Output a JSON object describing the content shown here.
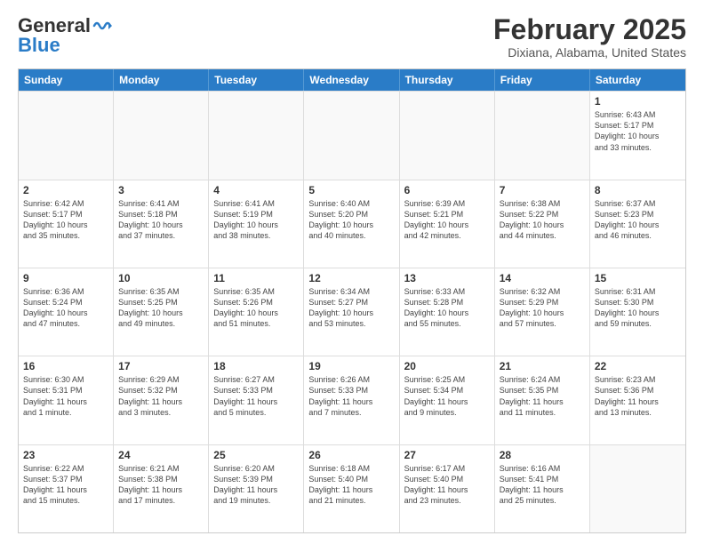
{
  "header": {
    "logo_general": "General",
    "logo_blue": "Blue",
    "month_title": "February 2025",
    "location": "Dixiana, Alabama, United States"
  },
  "weekdays": [
    "Sunday",
    "Monday",
    "Tuesday",
    "Wednesday",
    "Thursday",
    "Friday",
    "Saturday"
  ],
  "rows": [
    {
      "cells": [
        {
          "day": "",
          "info": ""
        },
        {
          "day": "",
          "info": ""
        },
        {
          "day": "",
          "info": ""
        },
        {
          "day": "",
          "info": ""
        },
        {
          "day": "",
          "info": ""
        },
        {
          "day": "",
          "info": ""
        },
        {
          "day": "1",
          "info": "Sunrise: 6:43 AM\nSunset: 5:17 PM\nDaylight: 10 hours\nand 33 minutes."
        }
      ]
    },
    {
      "cells": [
        {
          "day": "2",
          "info": "Sunrise: 6:42 AM\nSunset: 5:17 PM\nDaylight: 10 hours\nand 35 minutes."
        },
        {
          "day": "3",
          "info": "Sunrise: 6:41 AM\nSunset: 5:18 PM\nDaylight: 10 hours\nand 37 minutes."
        },
        {
          "day": "4",
          "info": "Sunrise: 6:41 AM\nSunset: 5:19 PM\nDaylight: 10 hours\nand 38 minutes."
        },
        {
          "day": "5",
          "info": "Sunrise: 6:40 AM\nSunset: 5:20 PM\nDaylight: 10 hours\nand 40 minutes."
        },
        {
          "day": "6",
          "info": "Sunrise: 6:39 AM\nSunset: 5:21 PM\nDaylight: 10 hours\nand 42 minutes."
        },
        {
          "day": "7",
          "info": "Sunrise: 6:38 AM\nSunset: 5:22 PM\nDaylight: 10 hours\nand 44 minutes."
        },
        {
          "day": "8",
          "info": "Sunrise: 6:37 AM\nSunset: 5:23 PM\nDaylight: 10 hours\nand 46 minutes."
        }
      ]
    },
    {
      "cells": [
        {
          "day": "9",
          "info": "Sunrise: 6:36 AM\nSunset: 5:24 PM\nDaylight: 10 hours\nand 47 minutes."
        },
        {
          "day": "10",
          "info": "Sunrise: 6:35 AM\nSunset: 5:25 PM\nDaylight: 10 hours\nand 49 minutes."
        },
        {
          "day": "11",
          "info": "Sunrise: 6:35 AM\nSunset: 5:26 PM\nDaylight: 10 hours\nand 51 minutes."
        },
        {
          "day": "12",
          "info": "Sunrise: 6:34 AM\nSunset: 5:27 PM\nDaylight: 10 hours\nand 53 minutes."
        },
        {
          "day": "13",
          "info": "Sunrise: 6:33 AM\nSunset: 5:28 PM\nDaylight: 10 hours\nand 55 minutes."
        },
        {
          "day": "14",
          "info": "Sunrise: 6:32 AM\nSunset: 5:29 PM\nDaylight: 10 hours\nand 57 minutes."
        },
        {
          "day": "15",
          "info": "Sunrise: 6:31 AM\nSunset: 5:30 PM\nDaylight: 10 hours\nand 59 minutes."
        }
      ]
    },
    {
      "cells": [
        {
          "day": "16",
          "info": "Sunrise: 6:30 AM\nSunset: 5:31 PM\nDaylight: 11 hours\nand 1 minute."
        },
        {
          "day": "17",
          "info": "Sunrise: 6:29 AM\nSunset: 5:32 PM\nDaylight: 11 hours\nand 3 minutes."
        },
        {
          "day": "18",
          "info": "Sunrise: 6:27 AM\nSunset: 5:33 PM\nDaylight: 11 hours\nand 5 minutes."
        },
        {
          "day": "19",
          "info": "Sunrise: 6:26 AM\nSunset: 5:33 PM\nDaylight: 11 hours\nand 7 minutes."
        },
        {
          "day": "20",
          "info": "Sunrise: 6:25 AM\nSunset: 5:34 PM\nDaylight: 11 hours\nand 9 minutes."
        },
        {
          "day": "21",
          "info": "Sunrise: 6:24 AM\nSunset: 5:35 PM\nDaylight: 11 hours\nand 11 minutes."
        },
        {
          "day": "22",
          "info": "Sunrise: 6:23 AM\nSunset: 5:36 PM\nDaylight: 11 hours\nand 13 minutes."
        }
      ]
    },
    {
      "cells": [
        {
          "day": "23",
          "info": "Sunrise: 6:22 AM\nSunset: 5:37 PM\nDaylight: 11 hours\nand 15 minutes."
        },
        {
          "day": "24",
          "info": "Sunrise: 6:21 AM\nSunset: 5:38 PM\nDaylight: 11 hours\nand 17 minutes."
        },
        {
          "day": "25",
          "info": "Sunrise: 6:20 AM\nSunset: 5:39 PM\nDaylight: 11 hours\nand 19 minutes."
        },
        {
          "day": "26",
          "info": "Sunrise: 6:18 AM\nSunset: 5:40 PM\nDaylight: 11 hours\nand 21 minutes."
        },
        {
          "day": "27",
          "info": "Sunrise: 6:17 AM\nSunset: 5:40 PM\nDaylight: 11 hours\nand 23 minutes."
        },
        {
          "day": "28",
          "info": "Sunrise: 6:16 AM\nSunset: 5:41 PM\nDaylight: 11 hours\nand 25 minutes."
        },
        {
          "day": "",
          "info": ""
        }
      ]
    }
  ]
}
